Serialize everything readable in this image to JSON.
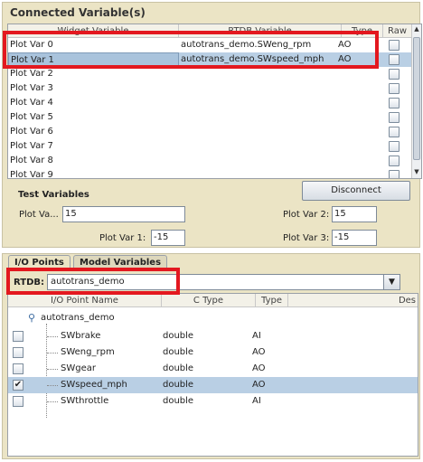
{
  "connected": {
    "title": "Connected Variable(s)",
    "columns": [
      "Widget Variable",
      "RTDB Variable",
      "Type",
      "Raw"
    ],
    "rows": [
      {
        "widget": "Plot Var 0",
        "rtdb": "autotrans_demo.SWeng_rpm",
        "type": "AO",
        "raw": false,
        "selected": false
      },
      {
        "widget": "Plot Var 1",
        "rtdb": "autotrans_demo.SWspeed_mph",
        "type": "AO",
        "raw": false,
        "selected": true
      },
      {
        "widget": "Plot Var 2",
        "rtdb": "",
        "type": "",
        "raw": false,
        "selected": false
      },
      {
        "widget": "Plot Var 3",
        "rtdb": "",
        "type": "",
        "raw": false,
        "selected": false
      },
      {
        "widget": "Plot Var 4",
        "rtdb": "",
        "type": "",
        "raw": false,
        "selected": false
      },
      {
        "widget": "Plot Var 5",
        "rtdb": "",
        "type": "",
        "raw": false,
        "selected": false
      },
      {
        "widget": "Plot Var 6",
        "rtdb": "",
        "type": "",
        "raw": false,
        "selected": false
      },
      {
        "widget": "Plot Var 7",
        "rtdb": "",
        "type": "",
        "raw": false,
        "selected": false
      },
      {
        "widget": "Plot Var 8",
        "rtdb": "",
        "type": "",
        "raw": false,
        "selected": false
      },
      {
        "widget": "Plot Var 9",
        "rtdb": "",
        "type": "",
        "raw": false,
        "selected": false
      }
    ]
  },
  "buttons": {
    "disconnect": "Disconnect"
  },
  "test": {
    "title": "Test Variables",
    "fields": [
      {
        "label": "Plot Va...",
        "value": "15"
      },
      {
        "label": "Plot Var 2:",
        "value": "15"
      },
      {
        "label": "Plot Var 1:",
        "value": "-15"
      },
      {
        "label": "Plot Var 3:",
        "value": "-15"
      }
    ]
  },
  "tabs": [
    "I/O Points",
    "Model Variables"
  ],
  "rtdb": {
    "label": "RTDB:",
    "value": "autotrans_demo"
  },
  "io_tree": {
    "columns": [
      "I/O Point Name",
      "C Type",
      "Type",
      "Des"
    ],
    "root": "autotrans_demo",
    "items": [
      {
        "name": "SWbrake",
        "ctype": "double",
        "type": "AI",
        "checked": false,
        "selected": false
      },
      {
        "name": "SWeng_rpm",
        "ctype": "double",
        "type": "AO",
        "checked": false,
        "selected": false
      },
      {
        "name": "SWgear",
        "ctype": "double",
        "type": "AO",
        "checked": false,
        "selected": false
      },
      {
        "name": "SWspeed_mph",
        "ctype": "double",
        "type": "AO",
        "checked": true,
        "selected": true
      },
      {
        "name": "SWthrottle",
        "ctype": "double",
        "type": "AI",
        "checked": false,
        "selected": false
      }
    ]
  },
  "icons": {
    "checkmark": "check-icon",
    "tree_root": "tree-node-icon",
    "combo_arrow": "triangle-down-icon"
  },
  "colors": {
    "panel": "#ebe4c5",
    "selection": "#b9cfe4",
    "highlight_box": "#e3181f"
  }
}
